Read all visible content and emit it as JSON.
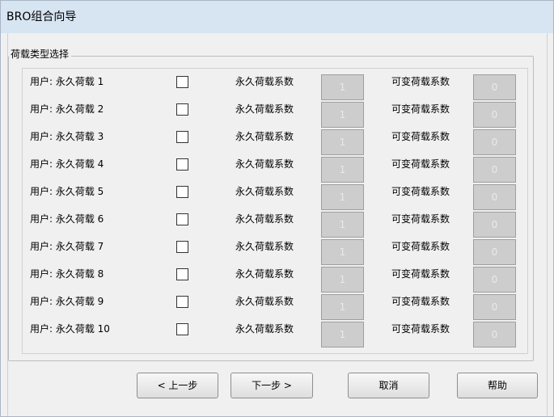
{
  "window": {
    "title": "BRO组合向导"
  },
  "group": {
    "title": "荷载类型选择"
  },
  "rows": [
    {
      "label": "用户: 永久荷载 1",
      "permanent_label": "永久荷载系数",
      "permanent_value": "1",
      "variable_label": "可变荷载系数",
      "variable_value": "0"
    },
    {
      "label": "用户: 永久荷载 2",
      "permanent_label": "永久荷载系数",
      "permanent_value": "1",
      "variable_label": "可变荷载系数",
      "variable_value": "0"
    },
    {
      "label": "用户: 永久荷载 3",
      "permanent_label": "永久荷载系数",
      "permanent_value": "1",
      "variable_label": "可变荷载系数",
      "variable_value": "0"
    },
    {
      "label": "用户: 永久荷载 4",
      "permanent_label": "永久荷载系数",
      "permanent_value": "1",
      "variable_label": "可变荷载系数",
      "variable_value": "0"
    },
    {
      "label": "用户: 永久荷载 5",
      "permanent_label": "永久荷载系数",
      "permanent_value": "1",
      "variable_label": "可变荷载系数",
      "variable_value": "0"
    },
    {
      "label": "用户: 永久荷载 6",
      "permanent_label": "永久荷载系数",
      "permanent_value": "1",
      "variable_label": "可变荷载系数",
      "variable_value": "0"
    },
    {
      "label": "用户: 永久荷载 7",
      "permanent_label": "永久荷载系数",
      "permanent_value": "1",
      "variable_label": "可变荷载系数",
      "variable_value": "0"
    },
    {
      "label": "用户: 永久荷载 8",
      "permanent_label": "永久荷载系数",
      "permanent_value": "1",
      "variable_label": "可变荷载系数",
      "variable_value": "0"
    },
    {
      "label": "用户: 永久荷载 9",
      "permanent_label": "永久荷载系数",
      "permanent_value": "1",
      "variable_label": "可变荷载系数",
      "variable_value": "0"
    },
    {
      "label": "用户: 永久荷载 10",
      "permanent_label": "永久荷载系数",
      "permanent_value": "1",
      "variable_label": "可变荷载系数",
      "variable_value": "0"
    }
  ],
  "buttons": {
    "prev_label": "< 上一步",
    "next_label": "下一步 >",
    "cancel_label": "取消",
    "help_label": "帮助"
  },
  "colors": {
    "titlebar": "#d7e4f2",
    "dialog_bg": "#f0f0f0",
    "disabled_field_bg": "#cdcdcd"
  }
}
